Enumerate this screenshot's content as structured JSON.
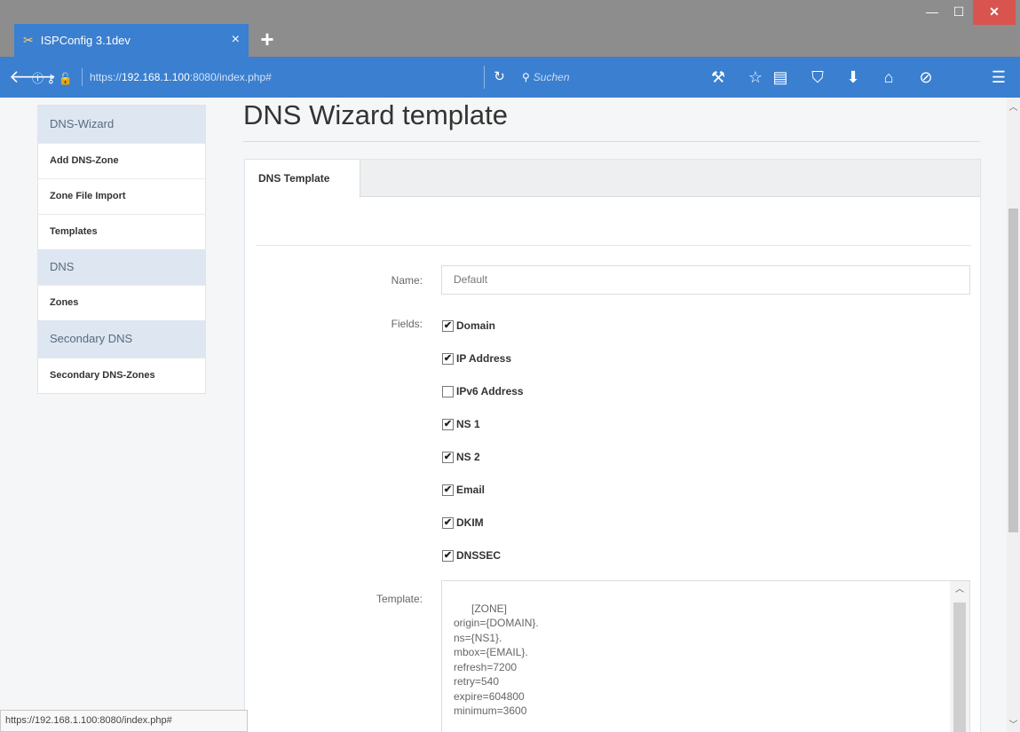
{
  "browser": {
    "tab_title": "ISPConfig 3.1dev",
    "tab_close": "×",
    "new_tab": "+",
    "url_scheme": "https://",
    "url_host": "192.168.1.100",
    "url_rest": ":8080/index.php#",
    "search_placeholder": "Suchen",
    "window_min": "—",
    "window_max": "☐",
    "window_close": "✕"
  },
  "sidebar": {
    "sections": [
      {
        "header": "DNS-Wizard",
        "items": [
          "Add DNS-Zone",
          "Zone File Import",
          "Templates"
        ]
      },
      {
        "header": "DNS",
        "items": [
          "Zones"
        ]
      },
      {
        "header": "Secondary DNS",
        "items": [
          "Secondary DNS-Zones"
        ]
      }
    ]
  },
  "main": {
    "title": "DNS Wizard template",
    "tab_label": "DNS Template",
    "name_label": "Name:",
    "name_value": "Default",
    "fields_label": "Fields:",
    "fields": [
      {
        "label": "Domain",
        "checked": true
      },
      {
        "label": "IP Address",
        "checked": true
      },
      {
        "label": "IPv6 Address",
        "checked": false
      },
      {
        "label": "NS 1",
        "checked": true
      },
      {
        "label": "NS 2",
        "checked": true
      },
      {
        "label": "Email",
        "checked": true
      },
      {
        "label": "DKIM",
        "checked": true
      },
      {
        "label": "DNSSEC",
        "checked": true
      }
    ],
    "template_label": "Template:",
    "template_value": "[ZONE]\norigin={DOMAIN}.\nns={NS1}.\nmbox={EMAIL}.\nrefresh=7200\nretry=540\nexpire=604800\nminimum=3600"
  },
  "statusbar": {
    "text": "https://192.168.1.100:8080/index.php#"
  },
  "colors": {
    "browser_blue": "#3a7fd0",
    "sidebar_header": "#dde6f1",
    "close_red": "#d9534f"
  }
}
